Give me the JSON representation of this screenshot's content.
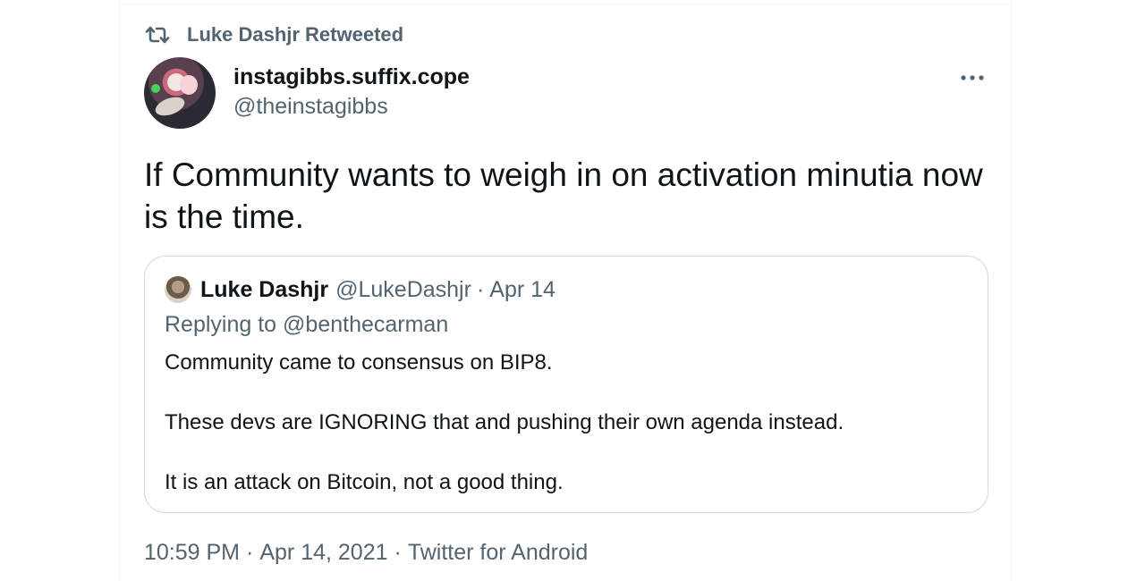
{
  "retweet": {
    "label": "Luke Dashjr Retweeted"
  },
  "tweet": {
    "author": {
      "display_name": "instagibbs.suffix.cope",
      "handle": "@theinstagibbs"
    },
    "text_line1": "If Community wants to weigh in on activation minutia now",
    "text_line2": "is the time.",
    "time": "10:59 PM",
    "date": "Apr 14, 2021",
    "separator": "·",
    "source": "Twitter for Android"
  },
  "quote": {
    "display_name": "Luke Dashjr",
    "handle": "@LukeDashjr",
    "separator": "·",
    "date": "Apr 14",
    "replying_label": "Replying to",
    "replying_to": "@benthecarman",
    "paragraphs": [
      "Community came to consensus on BIP8.",
      "These devs are IGNORING that and pushing their own agenda instead.",
      "It is an attack on Bitcoin, not a good thing."
    ]
  },
  "icons": {
    "retweet": "retweet-icon",
    "more": "more-horizontal-icon"
  },
  "colors": {
    "text_primary": "#0f1419",
    "text_secondary": "#536471",
    "border": "#cfd9de"
  }
}
